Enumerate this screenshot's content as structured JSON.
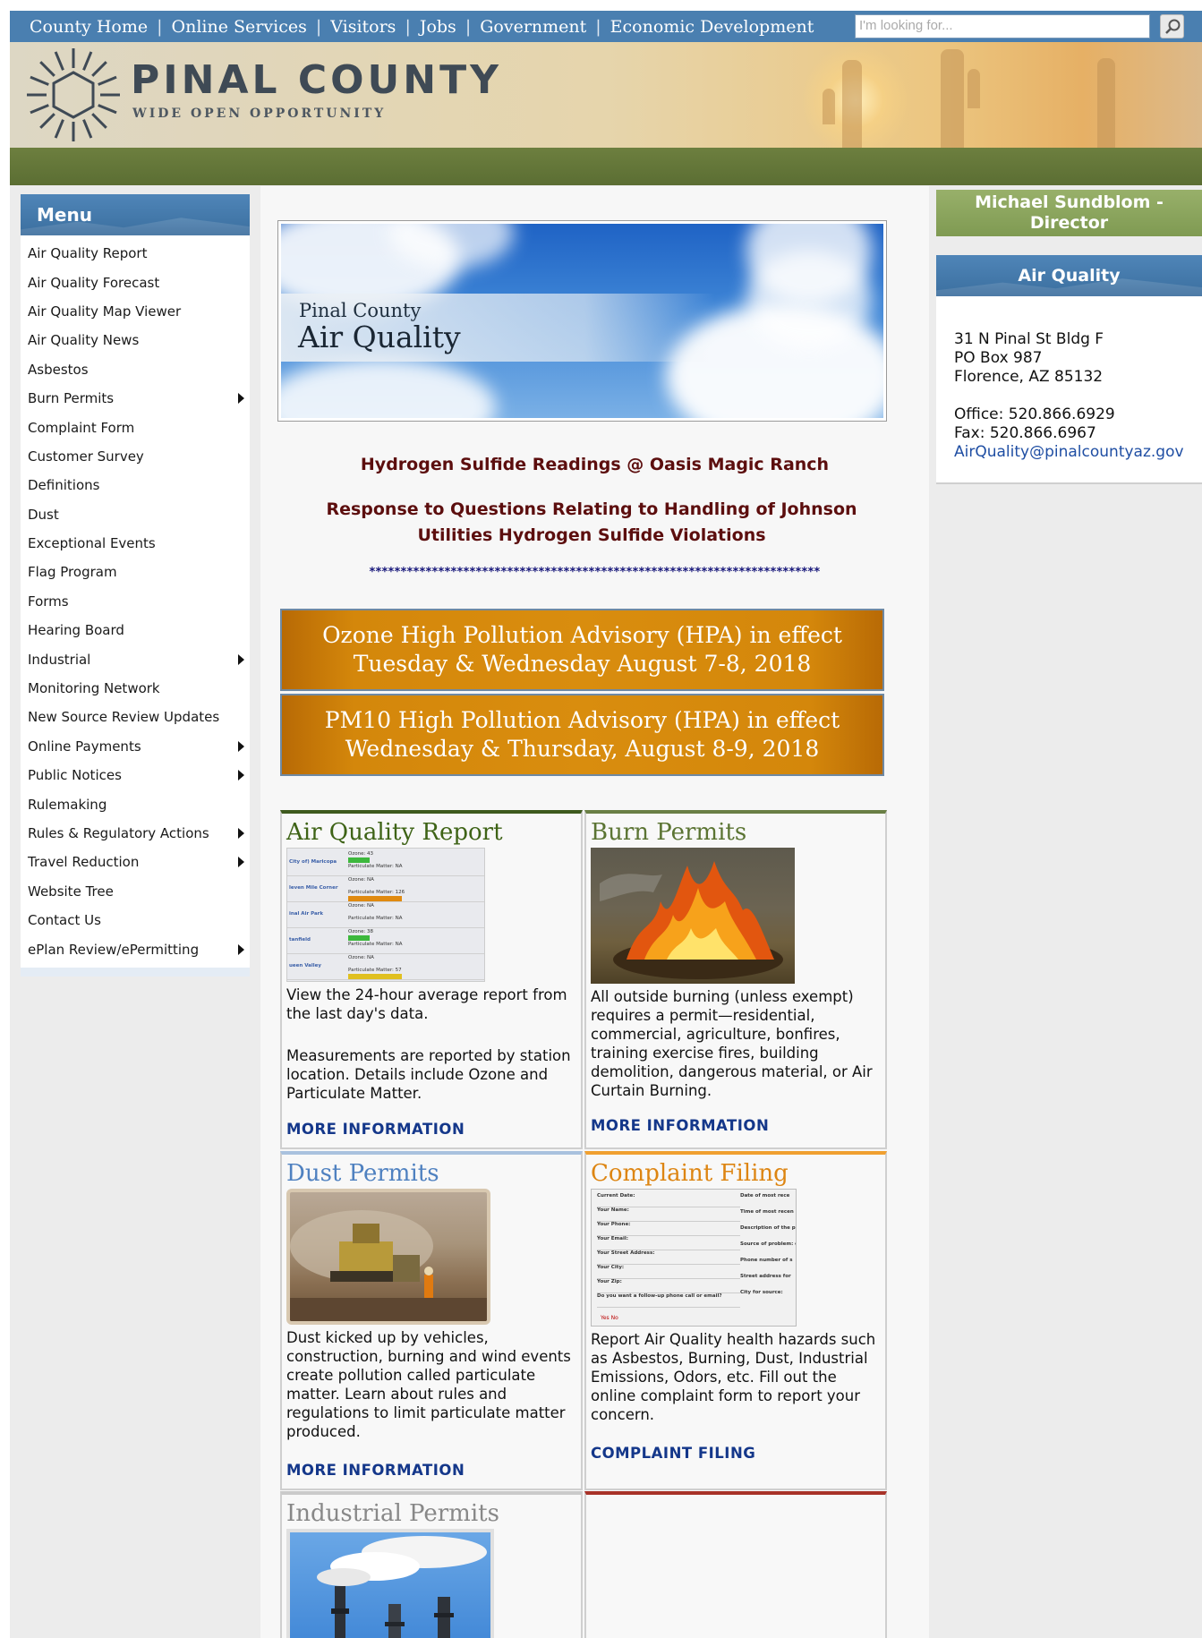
{
  "topnav": {
    "items": [
      "County Home",
      "Online Services",
      "Visitors",
      "Jobs",
      "Government",
      "Economic Development"
    ],
    "separator": "|",
    "search_placeholder": "I'm looking for..."
  },
  "banner": {
    "county_name": "PINAL COUNTY",
    "tagline": "WIDE OPEN OPPORTUNITY"
  },
  "menu": {
    "title": "Menu",
    "items": [
      {
        "label": "Air Quality Report",
        "submenu": false
      },
      {
        "label": "Air Quality Forecast",
        "submenu": false
      },
      {
        "label": "Air Quality Map Viewer",
        "submenu": false
      },
      {
        "label": "Air Quality News",
        "submenu": false
      },
      {
        "label": "Asbestos",
        "submenu": false
      },
      {
        "label": "Burn Permits",
        "submenu": true
      },
      {
        "label": "Complaint Form",
        "submenu": false
      },
      {
        "label": "Customer Survey",
        "submenu": false
      },
      {
        "label": "Definitions",
        "submenu": false
      },
      {
        "label": "Dust",
        "submenu": false
      },
      {
        "label": "Exceptional Events",
        "submenu": false
      },
      {
        "label": "Flag Program",
        "submenu": false
      },
      {
        "label": "Forms",
        "submenu": false
      },
      {
        "label": "Hearing Board",
        "submenu": false
      },
      {
        "label": "Industrial",
        "submenu": true
      },
      {
        "label": "Monitoring Network",
        "submenu": false
      },
      {
        "label": "New Source Review Updates",
        "submenu": false
      },
      {
        "label": "Online Payments",
        "submenu": true
      },
      {
        "label": "Public Notices",
        "submenu": true
      },
      {
        "label": "Rulemaking",
        "submenu": false
      },
      {
        "label": "Rules & Regulatory Actions",
        "submenu": true
      },
      {
        "label": "Travel Reduction",
        "submenu": true
      },
      {
        "label": "Website Tree",
        "submenu": false
      },
      {
        "label": "Contact Us",
        "submenu": false
      },
      {
        "label": "ePlan Review/ePermitting",
        "submenu": true
      }
    ]
  },
  "hero": {
    "line1": "Pinal County",
    "line2": "Air Quality"
  },
  "links": {
    "h2s": "Hydrogen Sulfide Readings @ Oasis Magic Ranch",
    "response": "Response to Questions Relating to Handling of Johnson Utilities Hydrogen Sulfide Violations",
    "stars": "************************************************************************"
  },
  "advisories": [
    "Ozone High Pollution Advisory (HPA) in effect Tuesday & Wednesday August 7-8, 2018",
    "PM10 High Pollution Advisory (HPA) in effect Wednesday & Thursday, August 8-9, 2018"
  ],
  "cards": {
    "aqr": {
      "title": "Air Quality Report",
      "text1": "View the 24-hour average report from the last day's data.",
      "text2": "Measurements are reported by station location. Details include Ozone and Particulate Matter.",
      "link": "MORE INFORMATION",
      "thumb_rows": [
        {
          "station": "City of) Maricopa",
          "ozone": "Ozone: 43",
          "pm": "Particulate Matter: NA"
        },
        {
          "station": "leven Mile Corner",
          "ozone": "Ozone: NA",
          "pm": "Particulate Matter: 126"
        },
        {
          "station": "inal Air Park",
          "ozone": "Ozone: NA",
          "pm": "Particulate Matter: NA"
        },
        {
          "station": "tanfield",
          "ozone": "Ozone: 38",
          "pm": "Particulate Matter: NA"
        },
        {
          "station": "ueen Valley",
          "ozone": "Ozone: NA",
          "pm": "Particulate Matter: 57"
        }
      ]
    },
    "burn": {
      "title": "Burn Permits",
      "text": "All outside burning (unless exempt) requires a permit—residential, commercial, agriculture, bonfires, training exercise fires, building demolition, dangerous material, or Air Curtain Burning.",
      "link": "MORE INFORMATION"
    },
    "dust": {
      "title": "Dust Permits",
      "text": "Dust kicked up by vehicles, construction,  burning and wind events create pollution called particulate matter. Learn about rules and regulations to limit particulate matter produced.",
      "link": "MORE INFORMATION"
    },
    "comp": {
      "title": "Complaint Filing",
      "text": "Report Air Quality health hazards such as Asbestos, Burning, Dust, Industrial Emissions, Odors, etc. Fill out the online complaint form to report your concern.",
      "link": "COMPLAINT FILING",
      "form_left": [
        "Current Date:",
        "Your Name:",
        "Your Phone:",
        "Your Email:",
        "Your Street Address:",
        "Your City:",
        "Your Zip:",
        "Do you want a follow-up phone call or email?"
      ],
      "form_right": [
        "Date of most rece",
        "Time of most recen",
        "Description of the p",
        "Source of problem: company name):",
        "Phone number of s",
        "Street address for",
        "City for source:"
      ],
      "form_choices": "Yes  No"
    },
    "ind": {
      "title": "Industrial Permits"
    }
  },
  "right": {
    "director": "Michael Sundblom - Director",
    "panel_title": "Air Quality",
    "address1": "31 N Pinal St Bldg F",
    "address2": "PO Box 987",
    "address3": "Florence, AZ 85132",
    "office": "Office: 520.866.6929",
    "fax": "Fax: 520.866.6967",
    "email": "AirQuality@pinalcountyaz.gov"
  },
  "colors": {
    "nav": "#4a7fb0",
    "advisory": "#d98d0e",
    "link_dark_red": "#5c0e0e",
    "more_info": "#14378a"
  }
}
